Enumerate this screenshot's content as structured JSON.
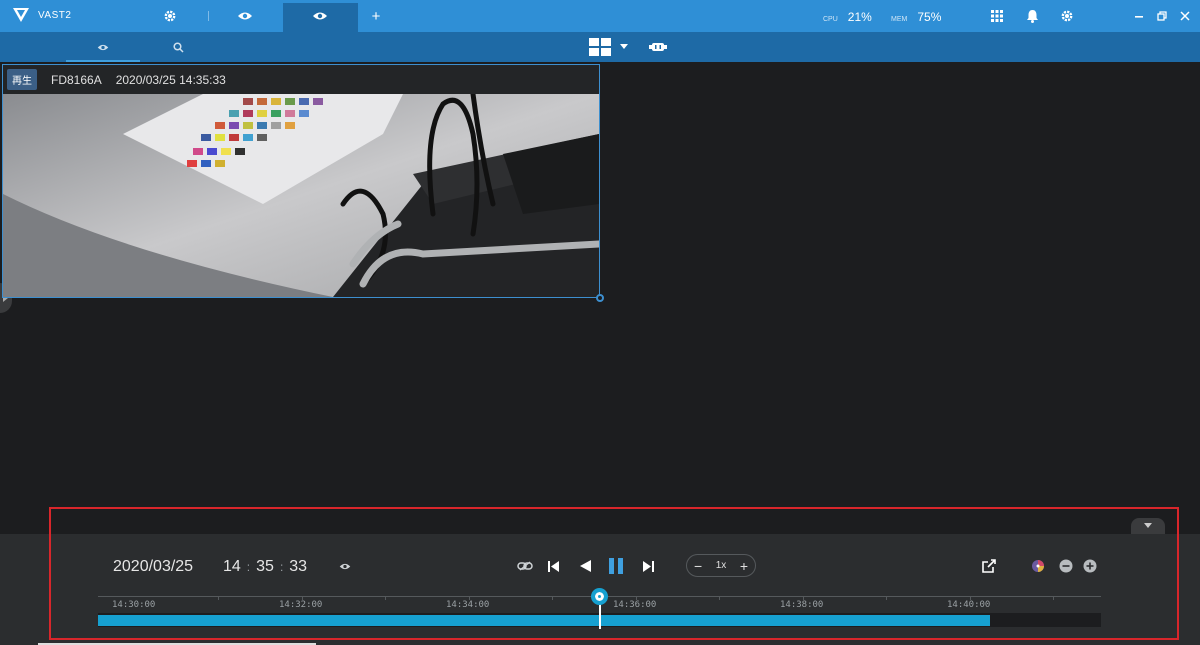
{
  "app": {
    "title": "VAST2"
  },
  "topbar": {
    "cpu_label": "CPU",
    "cpu_value": "21%",
    "mem_label": "MEM",
    "mem_value": "75%",
    "add_tab_label": "+"
  },
  "view": {
    "badge": "再生",
    "camera_name": "FD8166A",
    "camera_timestamp": "2020/03/25 14:35:33"
  },
  "playback": {
    "date": "2020/03/25",
    "time_hh": "14",
    "time_mm": "35",
    "time_ss": "33",
    "speed": "1x",
    "speed_minus": "−",
    "speed_plus": "+",
    "timeline_labels": [
      "14:30:00",
      "14:32:00",
      "14:34:00",
      "14:36:00",
      "14:38:00",
      "14:40:00"
    ]
  },
  "colors": {
    "topbar": "#2f8fd6",
    "accent": "#16a0d0",
    "highlight_frame": "#d8262b"
  },
  "icons": {
    "settings": "gear-icon",
    "live_view": "eye-icon",
    "search": "search-icon",
    "layout": "grid-layout-icon",
    "notifications": "bell-icon",
    "apps": "apps-grid-icon",
    "export": "export-icon",
    "sync": "link-icon"
  }
}
